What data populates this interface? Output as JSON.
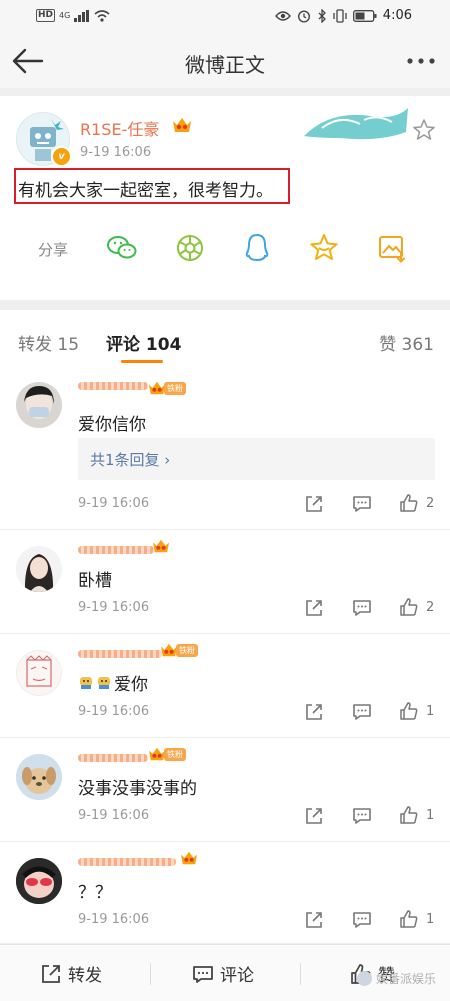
{
  "status_bar": {
    "hd": "HD",
    "signal": "4G",
    "time": "4:06"
  },
  "nav": {
    "title": "微博正文"
  },
  "post": {
    "author": "R1SE-任豪",
    "time": "9-19 16:06",
    "text": "有机会大家一起密室，很考智力。",
    "share_label": "分享"
  },
  "tabs": {
    "repost": "转发 15",
    "comment": "评论 104",
    "like": "赞 361"
  },
  "comments": [
    {
      "text": "爱你信你",
      "fan_badge": "铁粉",
      "reply_link": "共1条回复 ›",
      "time": "9-19 16:06",
      "likes": "2"
    },
    {
      "text": "卧槽",
      "time": "9-19 16:06",
      "likes": "2"
    },
    {
      "text": "爱你",
      "fan_badge": "铁粉",
      "time": "9-19 16:06",
      "likes": "1"
    },
    {
      "text": "没事没事没事的",
      "fan_badge": "铁粉",
      "time": "9-19 16:06",
      "likes": "1"
    },
    {
      "text": "？？",
      "time": "9-19 16:06",
      "likes": "1"
    }
  ],
  "bottom_bar": {
    "repost": "转发",
    "comment": "评论",
    "like": "赞"
  },
  "watermark": "娱番派娱乐",
  "colors": {
    "accent_orange": "#ff8200",
    "name_orange": "#eb7350",
    "link_blue": "#5a7ba6",
    "highlight_red": "#d4202a"
  }
}
